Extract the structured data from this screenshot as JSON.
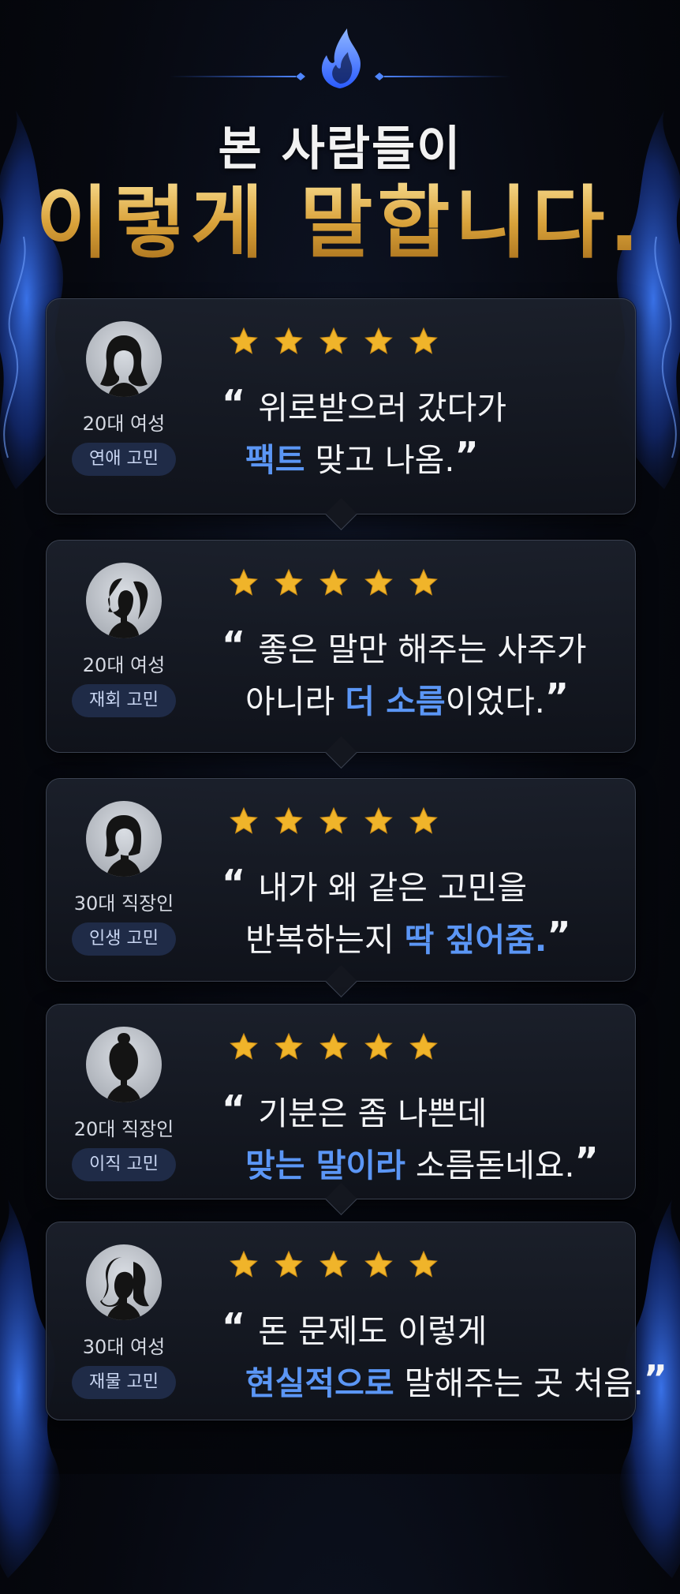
{
  "header": {
    "title_line1": "본 사람들이",
    "title_line2": "이렇게 말합니다."
  },
  "colors": {
    "accent_blue": "#5b96f5",
    "gold": "#d9a23a",
    "star": "#f0b42a",
    "tag_bg": "#1f2b47"
  },
  "reviews": [
    {
      "avatar_icon": "woman-long-hair-silhouette-icon",
      "person": "20대 여성",
      "tag": "연애 고민",
      "rating": 5,
      "line1": "위로받으러 갔다가",
      "line2_hl": "팩트",
      "line2_rest": " 맞고 나옴."
    },
    {
      "avatar_icon": "woman-ponytail-silhouette-icon",
      "person": "20대 여성",
      "tag": "재회 고민",
      "rating": 5,
      "line1": "좋은 말만 해주는 사주가",
      "line2_pre": "아니라 ",
      "line2_hl": "더 소름",
      "line2_rest": "이었다."
    },
    {
      "avatar_icon": "woman-short-hair-silhouette-icon",
      "person": "30대 직장인",
      "tag": "인생 고민",
      "rating": 5,
      "line1": "내가 왜 같은 고민을",
      "line2_pre": "반복하는지 ",
      "line2_hl": "딱 짚어줌."
    },
    {
      "avatar_icon": "woman-bun-silhouette-icon",
      "person": "20대 직장인",
      "tag": "이직 고민",
      "rating": 5,
      "line1": "기분은 좀 나쁜데",
      "line2_hl": "맞는 말이라",
      "line2_rest": " 소름돋네요."
    },
    {
      "avatar_icon": "woman-wavy-hair-silhouette-icon",
      "person": "30대 여성",
      "tag": "재물 고민",
      "rating": 5,
      "line1": "돈 문제도 이렇게",
      "line2_hl": "현실적으로",
      "line2_rest": " 말해주는 곳 처음."
    }
  ]
}
